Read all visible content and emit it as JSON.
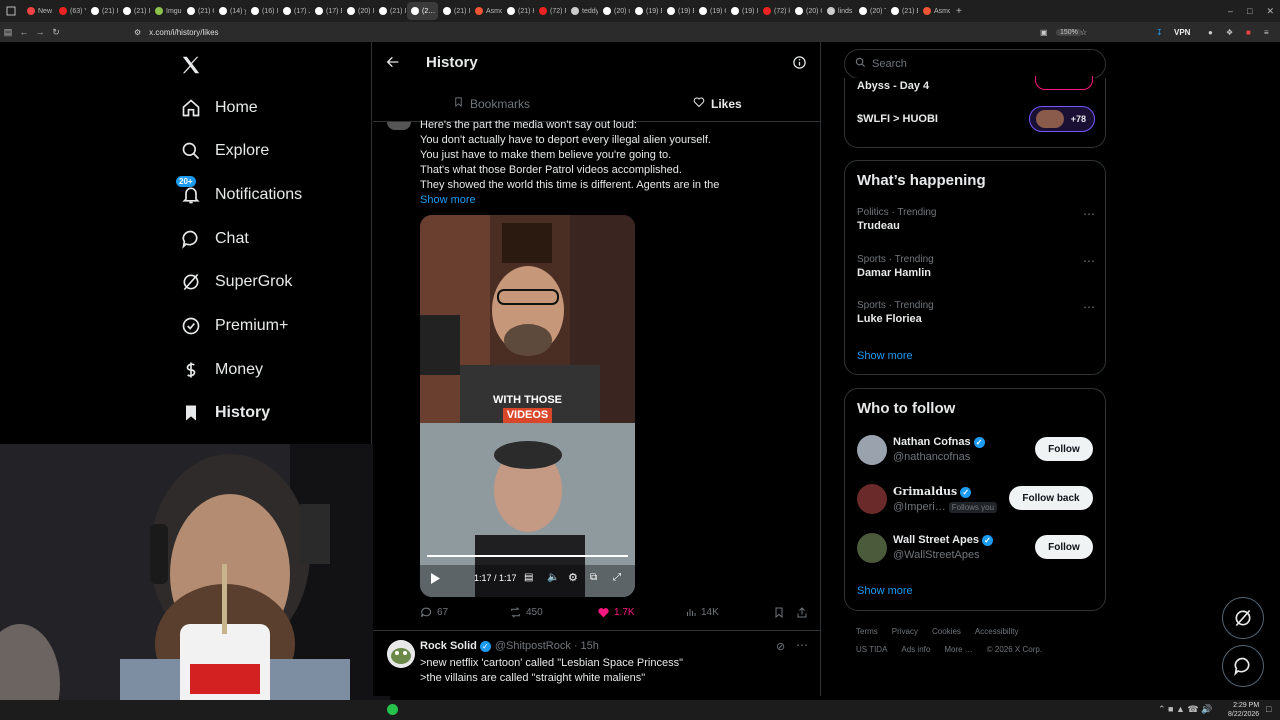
{
  "browser": {
    "tabs": [
      {
        "label": "New",
        "color": "#e44"
      },
      {
        "label": "(63) Y",
        "color": "#e22"
      },
      {
        "label": "(21) I",
        "color": "#fff"
      },
      {
        "label": "(21) I",
        "color": "#fff"
      },
      {
        "label": "Imgu",
        "color": "#8bc34a"
      },
      {
        "label": "(21) C",
        "color": "#fff"
      },
      {
        "label": "(14) y",
        "color": "#fff"
      },
      {
        "label": "(16) I",
        "color": "#fff"
      },
      {
        "label": "(17) Ji",
        "color": "#fff"
      },
      {
        "label": "(17) E",
        "color": "#fff"
      },
      {
        "label": "(20) I",
        "color": "#fff"
      },
      {
        "label": "(21) I",
        "color": "#fff"
      },
      {
        "label": "(2…",
        "color": "#fff",
        "active": true
      },
      {
        "label": "(21) I",
        "color": "#fff"
      },
      {
        "label": "Asmo",
        "color": "#e53"
      },
      {
        "label": "(21) H",
        "color": "#fff"
      },
      {
        "label": "(72) P",
        "color": "#e22"
      },
      {
        "label": "teddy",
        "color": "#ccc"
      },
      {
        "label": "(20) u",
        "color": "#fff"
      },
      {
        "label": "(19) E",
        "color": "#fff"
      },
      {
        "label": "(19) E",
        "color": "#fff"
      },
      {
        "label": "(19) C",
        "color": "#fff"
      },
      {
        "label": "(19) I",
        "color": "#fff"
      },
      {
        "label": "(72) k",
        "color": "#e22"
      },
      {
        "label": "(20) C",
        "color": "#fff"
      },
      {
        "label": "linds",
        "color": "#ccc"
      },
      {
        "label": "(20) T",
        "color": "#fff"
      },
      {
        "label": "(21) E",
        "color": "#fff"
      },
      {
        "label": "Asmo",
        "color": "#e53"
      }
    ],
    "url": "x.com/i/history/likes",
    "zoom": "150%",
    "vpn": "VPN"
  },
  "nav": {
    "home": "Home",
    "explore": "Explore",
    "notifications": "Notifications",
    "notif_badge": "20+",
    "chat": "Chat",
    "supergrok": "SuperGrok",
    "premium": "Premium+",
    "money": "Money",
    "history": "History"
  },
  "header": {
    "title": "History",
    "tab_bookmarks": "Bookmarks",
    "tab_likes": "Likes"
  },
  "post1": {
    "lines": [
      "Here's the part the media won't say out loud:",
      "You don't actually have to deport every illegal alien yourself.",
      "You just have to make them believe you're going to.",
      "That's what those Border Patrol videos accomplished.",
      "They showed the world this time is different. Agents are in the"
    ],
    "show_more": "Show more",
    "video": {
      "caption_line1": "WITH THOSE",
      "caption_line2": "VIDEOS",
      "time": "1:17 / 1:17",
      "progress": 1.0
    },
    "replies": "67",
    "reposts": "450",
    "likes": "1.7K",
    "views": "14K"
  },
  "post2": {
    "name": "Rock Solid",
    "handle": "@ShitpostRock",
    "time": "15h",
    "line1": ">new netflix 'cartoon' called \"Lesbian Space Princess\"",
    "line2": ">the villains are called \"straight white maliens\""
  },
  "search": {
    "placeholder": "Search"
  },
  "spaces": {
    "item1": "Abyss - Day 4",
    "item2": "$WLFI > HUOBI",
    "item2_count": "+78"
  },
  "happening": {
    "title": "What’s happening",
    "trends": [
      {
        "context": "Politics · Trending",
        "name": "Trudeau"
      },
      {
        "context": "Sports · Trending",
        "name": "Damar Hamlin"
      },
      {
        "context": "Sports · Trending",
        "name": "Luke Floriea"
      }
    ],
    "show_more": "Show more"
  },
  "who_to_follow": {
    "title": "Who to follow",
    "users": [
      {
        "name": "Nathan Cofnas",
        "handle": "@nathancofnas",
        "button": "Follow"
      },
      {
        "name": "Grimaldus",
        "handle": "@Imperi…",
        "follows_you": "Follows you",
        "button": "Follow back"
      },
      {
        "name": "Wall Street Apes",
        "handle": "@WallStreetApes",
        "button": "Follow"
      }
    ],
    "show_more": "Show more"
  },
  "footer": {
    "links": [
      "Terms",
      "Privacy",
      "Cookies",
      "Accessibility"
    ],
    "links2": [
      "US TIDA",
      "Ads info",
      "More …",
      "© 2026 X Corp."
    ]
  },
  "taskbar": {
    "time": "2:29 PM",
    "date": "8/22/2026"
  }
}
